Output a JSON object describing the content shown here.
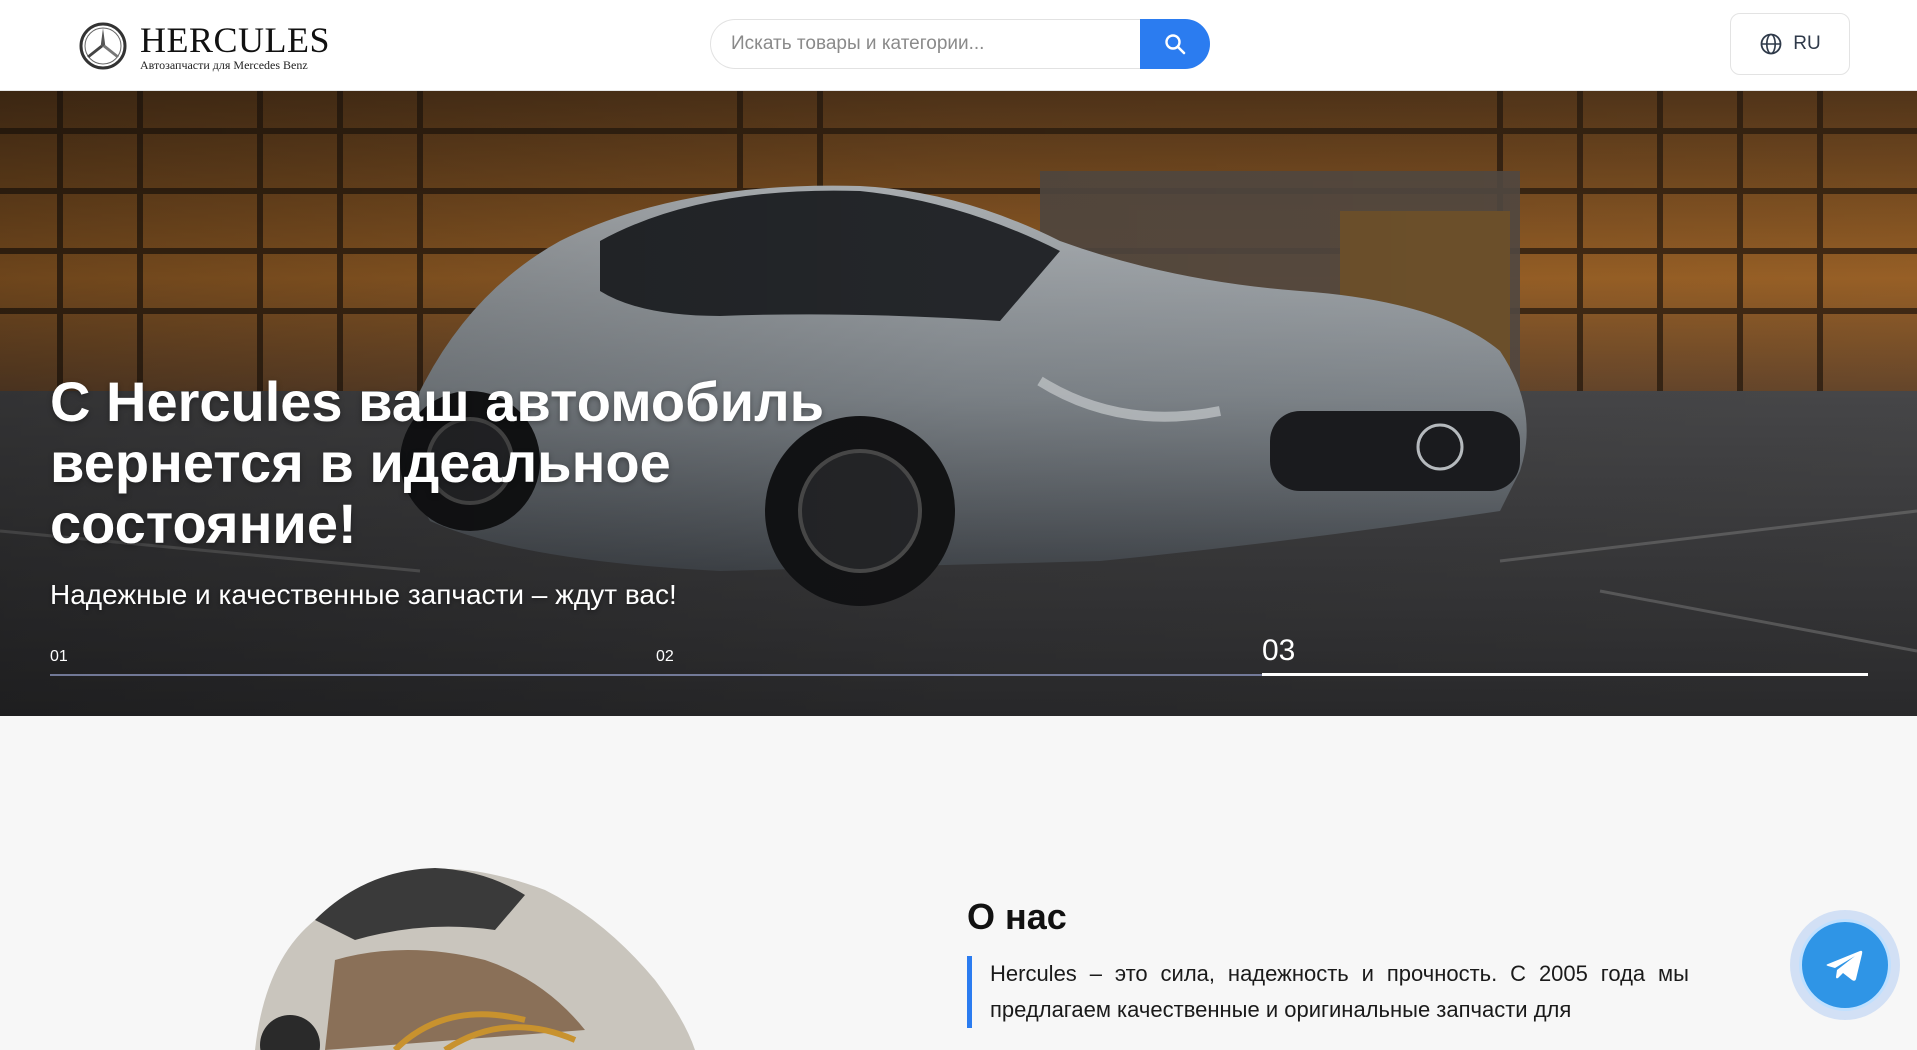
{
  "header": {
    "logo_title": "HERCULES",
    "logo_subtitle": "Автозапчасти для Mercedes Benz",
    "logo_icon": "mercedes-star-icon",
    "search_placeholder": "Искать товары и категории...",
    "search_icon": "search-icon",
    "language": "RU",
    "language_icon": "globe-icon"
  },
  "hero": {
    "title": "С Hercules ваш автомобиль вернется в идеальное состояние!",
    "subtitle": "Надежные и качественные запчасти – ждут вас!",
    "slides": [
      {
        "label": "01",
        "active": false
      },
      {
        "label": "02",
        "active": false
      },
      {
        "label": "03",
        "active": true
      }
    ]
  },
  "about": {
    "title": "О нас",
    "text": "Hercules – это сила, надежность и прочность. С 2005 года мы предлагаем качественные и оригинальные запчасти для"
  },
  "floating": {
    "telegram_icon": "telegram-icon"
  },
  "colors": {
    "accent": "#2b7cf0",
    "telegram": "#2f95e6"
  }
}
